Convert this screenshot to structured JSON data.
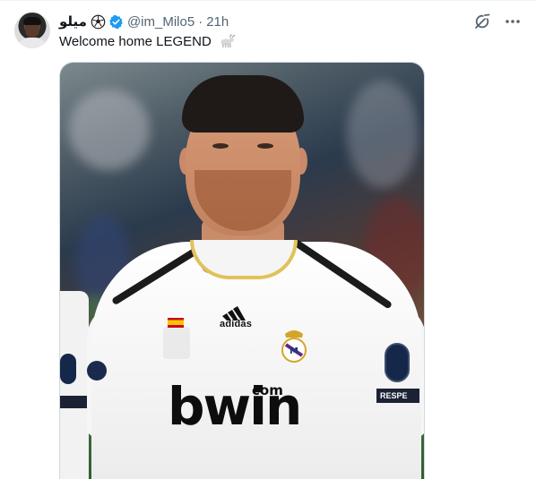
{
  "post": {
    "display_name": "ميلو",
    "handle": "@im_Milo5",
    "separator": "·",
    "time": "21h",
    "text": "Welcome home LEGEND",
    "emoji": "goat",
    "badges": [
      "soccer-ball-icon",
      "verified-icon"
    ],
    "actions": [
      "grok-icon",
      "more-icon"
    ]
  },
  "media": {
    "jersey_sponsor": "bwin",
    "jersey_sponsor_suffix": "com",
    "jersey_brand": "adidas",
    "sleeve_text": "RESPE"
  },
  "colors": {
    "text_primary": "#0f1419",
    "text_secondary": "#536471",
    "verified": "#1d9bf0",
    "border": "#cfd9de"
  }
}
